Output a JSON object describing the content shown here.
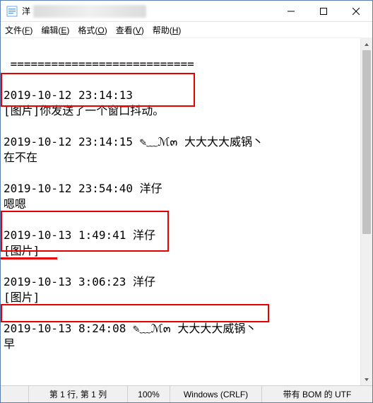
{
  "window": {
    "title_prefix": "洋",
    "min_tooltip": "Minimize",
    "max_tooltip": "Maximize",
    "close_tooltip": "Close"
  },
  "menu": {
    "file": "文件(F)",
    "edit": "编辑(E)",
    "format": "格式(O)",
    "view": "查看(V)",
    "help": "帮助(H)"
  },
  "text": {
    "separator": " ===========================",
    "blank": " ",
    "l1": "2019-10-12 23:14:13",
    "l2": "[图片]你发送了一个窗口抖动。",
    "l3": "2019-10-12 23:14:15 ✎﹏ℳ๓ 大大大大威锅丶",
    "l4": "在不在",
    "l5": "2019-10-12 23:54:40 洋仔",
    "l6": "嗯嗯",
    "l7": "2019-10-13 1:49:41 洋仔",
    "l8": "[图片]",
    "l9": "2019-10-13 3:06:23 洋仔",
    "l10": "[图片]",
    "l11": "2019-10-13 8:24:08 ✎﹏ℳ๓ 大大大大威锅丶",
    "l12": "早"
  },
  "status": {
    "pos": "第 1 行, 第 1 列",
    "zoom": "100%",
    "eol": "Windows (CRLF)",
    "enc": "带有 BOM 的 UTF"
  },
  "colors": {
    "red": "#e60000",
    "border": "#5a7fb0"
  }
}
